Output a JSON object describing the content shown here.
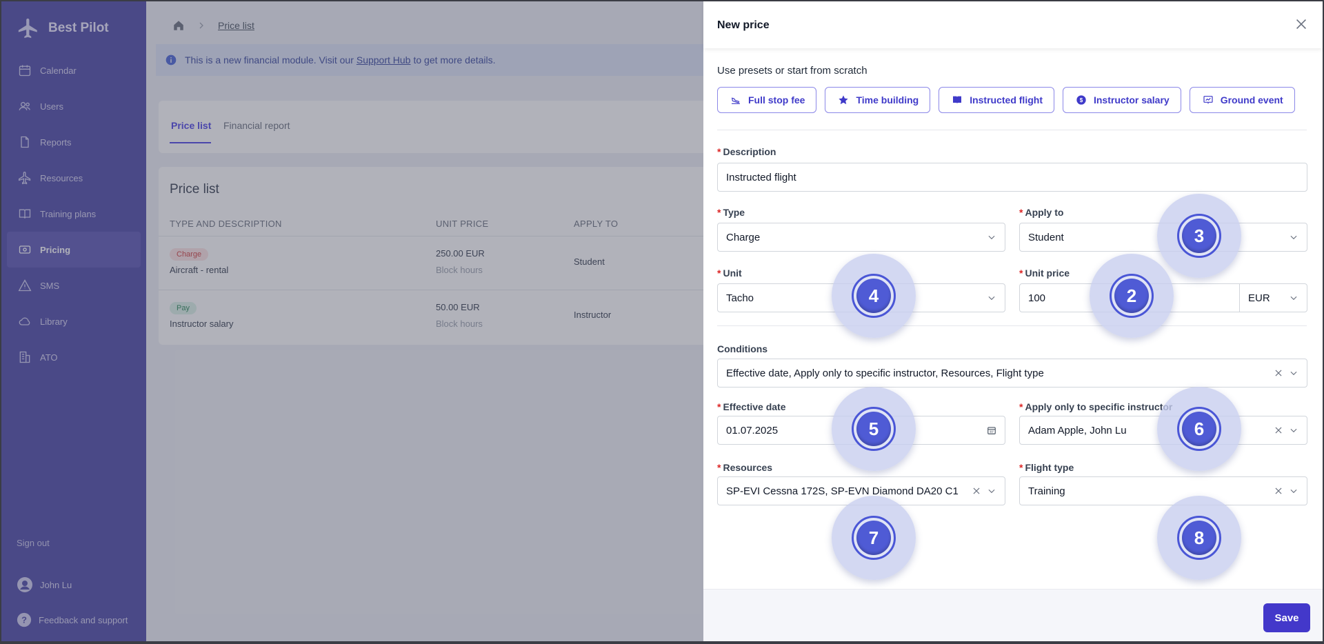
{
  "app": {
    "brand": "Best Pilot",
    "nav": [
      {
        "label": "Calendar",
        "icon": "calendar-icon"
      },
      {
        "label": "Users",
        "icon": "users-icon"
      },
      {
        "label": "Reports",
        "icon": "reports-icon"
      },
      {
        "label": "Resources",
        "icon": "plane-icon"
      },
      {
        "label": "Training plans",
        "icon": "book-icon"
      },
      {
        "label": "Pricing",
        "icon": "pricing-icon"
      },
      {
        "label": "SMS",
        "icon": "warning-icon"
      },
      {
        "label": "Library",
        "icon": "cloud-icon"
      },
      {
        "label": "ATO",
        "icon": "building-icon"
      }
    ],
    "active_nav": "Pricing",
    "sign_out": "Sign out",
    "user_name": "John Lu",
    "feedback": "Feedback and support"
  },
  "page": {
    "breadcrumb_current": "Price list",
    "banner_prefix": "This is a new financial module. Visit our",
    "banner_link": "Support Hub",
    "banner_suffix": "to get more details.",
    "tabs": [
      "Price list",
      "Financial report"
    ],
    "list_title": "Price list",
    "columns": [
      "TYPE AND DESCRIPTION",
      "UNIT PRICE",
      "APPLY TO"
    ],
    "rows": [
      {
        "badge": "Charge",
        "description": "Aircraft - rental",
        "price": "250.00 EUR",
        "unit": "Block hours",
        "apply_to": "Student"
      },
      {
        "badge": "Pay",
        "description": "Instructor salary",
        "price": "50.00 EUR",
        "unit": "Block hours",
        "apply_to": "Instructor"
      }
    ]
  },
  "drawer": {
    "title": "New price",
    "presets_label": "Use presets or start from scratch",
    "presets": [
      {
        "label": "Full stop fee",
        "icon": "landing-icon"
      },
      {
        "label": "Time building",
        "icon": "star-icon"
      },
      {
        "label": "Instructed flight",
        "icon": "book-open-icon"
      },
      {
        "label": "Instructor salary",
        "icon": "coin-icon"
      },
      {
        "label": "Ground event",
        "icon": "presentation-icon"
      }
    ],
    "description_label": "Description",
    "description_value": "Instructed flight",
    "type_label": "Type",
    "type_value": "Charge",
    "apply_to_label": "Apply to",
    "apply_to_value": "Student",
    "unit_label": "Unit",
    "unit_value": "Tacho",
    "unit_price_label": "Unit price",
    "unit_price_value": "100",
    "currency_value": "EUR",
    "conditions_label": "Conditions",
    "conditions_value": "Effective date, Apply only to specific instructor, Resources, Flight type",
    "effective_date_label": "Effective date",
    "effective_date_value": "01.07.2025",
    "instructor_label": "Apply only to specific instructor",
    "instructor_value": "Adam Apple, John Lu",
    "resources_label": "Resources",
    "resources_value": "SP-EVI Cessna 172S, SP-EVN Diamond DA20 C1",
    "flight_type_label": "Flight type",
    "flight_type_value": "Training",
    "save_label": "Save",
    "required_mark": "*"
  },
  "markers": [
    "3",
    "4",
    "2",
    "5",
    "6",
    "7",
    "8"
  ],
  "colors": {
    "accent": "#4338ca",
    "sidebar": "#4f4aa8",
    "marker": "#4f5bd5"
  }
}
